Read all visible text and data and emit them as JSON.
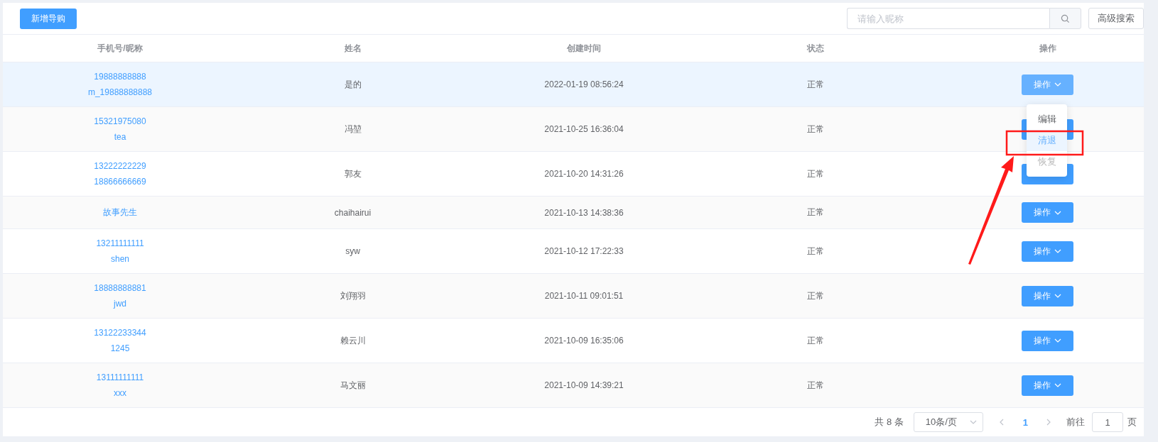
{
  "toolbar": {
    "add_button": "新增导购",
    "search": {
      "placeholder": "请输入昵称"
    },
    "advanced_search_button": "高级搜索"
  },
  "table": {
    "columns": [
      "手机号/昵称",
      "姓名",
      "创建时间",
      "状态",
      "操作"
    ],
    "rows": [
      {
        "account_lines": [
          "19888888888",
          "m_19888888888"
        ],
        "name": "是的",
        "created": "2022-01-19 08:56:24",
        "status": "正常",
        "action": "操作",
        "hovered": true
      },
      {
        "account_lines": [
          "15321975080",
          "tea"
        ],
        "name": "冯堃",
        "created": "2021-10-25 16:36:04",
        "status": "正常",
        "hovered": false
      },
      {
        "account_lines": [
          "13222222229",
          "18866666669"
        ],
        "name": "郭友",
        "created": "2021-10-20 14:31:26",
        "status": "正常",
        "hovered": false
      },
      {
        "account_lines": [
          "故事先生"
        ],
        "name": "chaihairui",
        "created": "2021-10-13 14:38:36",
        "status": "正常",
        "action": "操作",
        "hovered": false
      },
      {
        "account_lines": [
          "13211111111",
          "shen"
        ],
        "name": "syw",
        "created": "2021-10-12 17:22:33",
        "status": "正常",
        "action": "操作",
        "hovered": false
      },
      {
        "account_lines": [
          "18888888881",
          "jwd"
        ],
        "name": "刘翔羽",
        "created": "2021-10-11 09:01:51",
        "status": "正常",
        "action": "操作",
        "hovered": false
      },
      {
        "account_lines": [
          "13122233344",
          "1245"
        ],
        "name": "赖云川",
        "created": "2021-10-09 16:35:06",
        "status": "正常",
        "action": "操作",
        "hovered": false
      },
      {
        "account_lines": [
          "13111111111",
          "xxx"
        ],
        "name": "马文丽",
        "created": "2021-10-09 14:39:21",
        "status": "正常",
        "action": "操作",
        "hovered": false
      }
    ]
  },
  "dropdown": {
    "items": [
      {
        "label": "编辑",
        "highlighted": false,
        "disabled": false
      },
      {
        "label": "清退",
        "highlighted": true,
        "disabled": false
      },
      {
        "label": "恢复",
        "highlighted": false,
        "disabled": true
      }
    ]
  },
  "pagination": {
    "total": "共 8 条",
    "page_size": "10条/页",
    "pages": [
      {
        "label": "1",
        "selected": true
      }
    ],
    "goto_label": "前往",
    "goto_value": "1",
    "page_unit": "页"
  }
}
